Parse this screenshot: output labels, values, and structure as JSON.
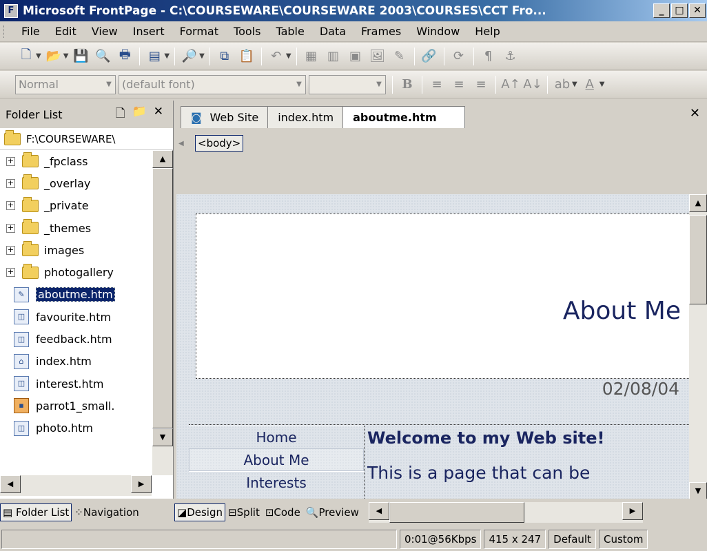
{
  "titlebar": {
    "app_icon": "F",
    "title": "Microsoft FrontPage - C:\\COURSEWARE\\COURSEWARE 2003\\COURSES\\CCT Fro...",
    "controls": [
      "minimize-icon",
      "maximize-icon",
      "close-icon"
    ]
  },
  "menu": [
    "File",
    "Edit",
    "View",
    "Insert",
    "Format",
    "Tools",
    "Table",
    "Data",
    "Frames",
    "Window",
    "Help"
  ],
  "format_toolbar": {
    "style_value": "Normal",
    "font_value": "(default font)",
    "size_value": ""
  },
  "folder_pane": {
    "title": "Folder List",
    "root": "F:\\COURSEWARE\\",
    "folders": [
      "_fpclass",
      "_overlay",
      "_private",
      "_themes",
      "images",
      "photogallery"
    ],
    "files": [
      "aboutme.htm",
      "favourite.htm",
      "feedback.htm",
      "index.htm",
      "interest.htm",
      "parrot1_small.",
      "photo.htm"
    ],
    "selected_file": "aboutme.htm",
    "tabs": [
      "Folder List",
      "Navigation"
    ]
  },
  "document": {
    "tabs": [
      "Web Site",
      "index.htm",
      "aboutme.htm"
    ],
    "active_tab": "aboutme.htm",
    "tag": "<body>",
    "banner_title": "About Me",
    "date": "02/08/04",
    "nav_links": [
      "Home",
      "About Me",
      "Interests"
    ],
    "welcome": "Welcome to my Web site!",
    "paragraph": "This is a page that can be",
    "view_tabs": [
      "Design",
      "Split",
      "Code",
      "Preview"
    ],
    "active_view": "Design"
  },
  "statusbar": {
    "download": "0:01@56Kbps",
    "dimensions": "415 x 247",
    "mode": "Default",
    "custom": "Custom"
  }
}
